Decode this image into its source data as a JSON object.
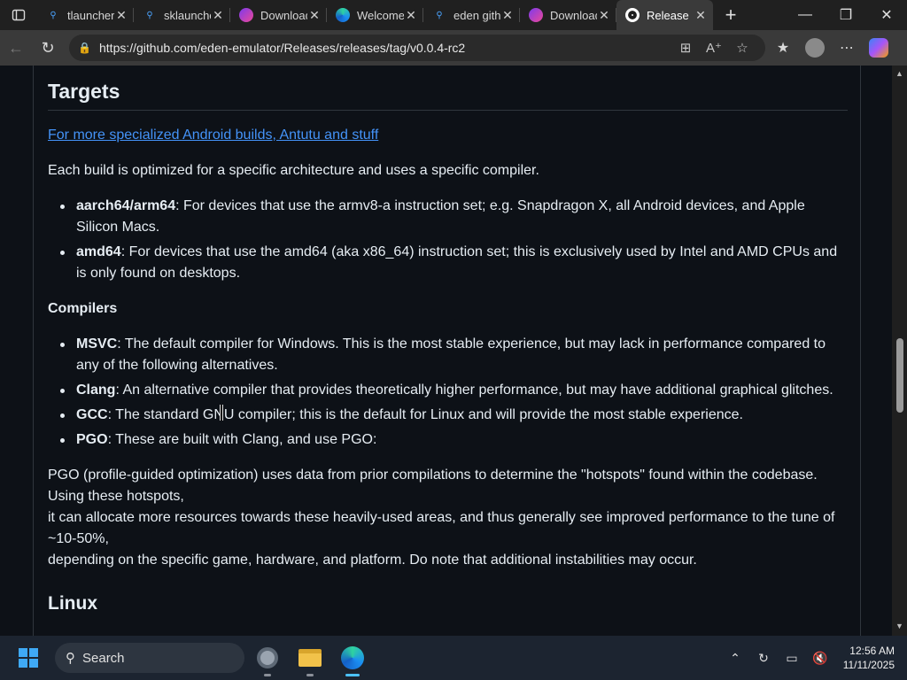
{
  "browser": {
    "tabs": [
      {
        "title": "tlauncher",
        "favicon": "search-icon",
        "active": false
      },
      {
        "title": "sklauncher",
        "favicon": "search-icon",
        "active": false
      },
      {
        "title": "Downloads",
        "favicon": "eden-icon",
        "active": false
      },
      {
        "title": "Welcome",
        "favicon": "edge-icon",
        "active": false
      },
      {
        "title": "eden github",
        "favicon": "search-icon",
        "active": false
      },
      {
        "title": "Downloads",
        "favicon": "eden-icon",
        "active": false
      },
      {
        "title": "Release",
        "favicon": "github-icon",
        "active": true
      }
    ],
    "url": "https://github.com/eden-emulator/Releases/releases/tag/v0.0.4-rc2"
  },
  "page": {
    "targets_heading": "Targets",
    "targets_link": "For more specialized Android builds, Antutu and stuff",
    "targets_intro": "Each build is optimized for a specific architecture and uses a specific compiler.",
    "targets_list": [
      {
        "term": "aarch64/arm64",
        "desc": ": For devices that use the armv8-a instruction set; e.g. Snapdragon X, all Android devices, and Apple Silicon Macs."
      },
      {
        "term": "amd64",
        "desc": ": For devices that use the amd64 (aka x86_64) instruction set; this is exclusively used by Intel and AMD CPUs and is only found on desktops."
      }
    ],
    "compilers_heading": "Compilers",
    "compilers_list": [
      {
        "term": "MSVC",
        "desc": ": The default compiler for Windows. This is the most stable experience, but may lack in performance compared to any of the following alternatives."
      },
      {
        "term": "Clang",
        "desc": ": An alternative compiler that provides theoretically higher performance, but may have additional graphical glitches."
      },
      {
        "term": "GCC",
        "desc": ": The standard GNU compiler; this is the default for Linux and will provide the most stable experience."
      },
      {
        "term": "PGO",
        "desc": ": These are built with Clang, and use PGO:"
      }
    ],
    "pgo_lines": [
      "PGO (profile-guided optimization) uses data from prior compilations to determine the \"hotspots\" found within the codebase. Using these hotspots,",
      "it can allocate more resources towards these heavily-used areas, and thus generally see improved performance to the tune of ~10-50%,",
      "depending on the specific game, hardware, and platform. Do note that additional instabilities may occur."
    ],
    "linux_heading": "Linux"
  },
  "taskbar": {
    "search_label": "Search",
    "time": "12:56 AM",
    "date": "11/11/2025"
  }
}
